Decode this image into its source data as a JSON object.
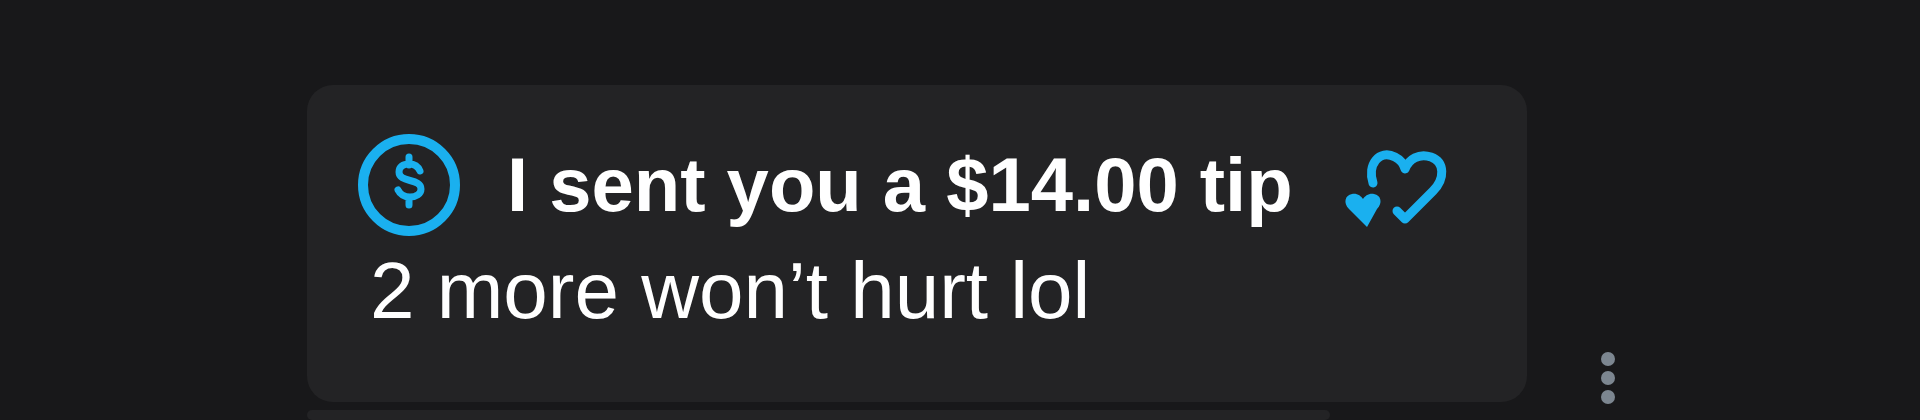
{
  "message": {
    "title": "I sent you a $14.00 tip",
    "body": "2 more won’t hurt lol"
  }
}
